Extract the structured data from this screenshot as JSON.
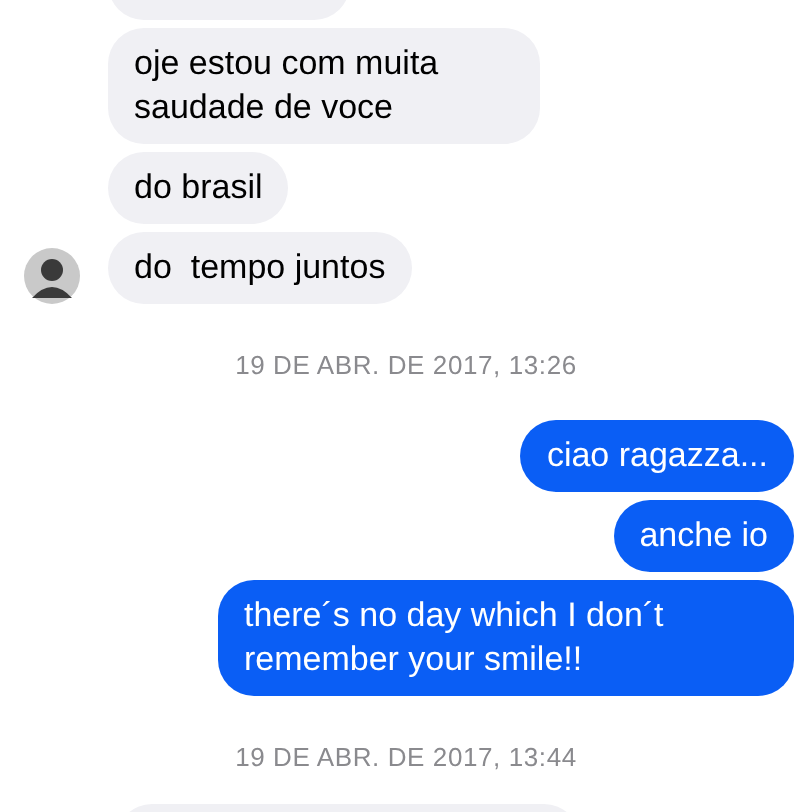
{
  "messages": [
    {
      "kind": "clipped_incoming"
    },
    {
      "kind": "incoming",
      "text": "oje estou com muita saudade de voce",
      "avatar": false
    },
    {
      "kind": "incoming",
      "text": "do brasil",
      "avatar": false
    },
    {
      "kind": "incoming",
      "text": "do  tempo juntos",
      "avatar": true
    },
    {
      "kind": "timestamp",
      "text": "19 DE ABR. DE 2017, 13:26"
    },
    {
      "kind": "outgoing",
      "text": "ciao ragazza..."
    },
    {
      "kind": "outgoing",
      "text": "anche io"
    },
    {
      "kind": "outgoing",
      "text": "there´s no day which I don´t remember your smile!!"
    },
    {
      "kind": "timestamp",
      "text": "19 DE ABR. DE 2017, 13:44"
    },
    {
      "kind": "clipped_incoming_bottom"
    }
  ]
}
